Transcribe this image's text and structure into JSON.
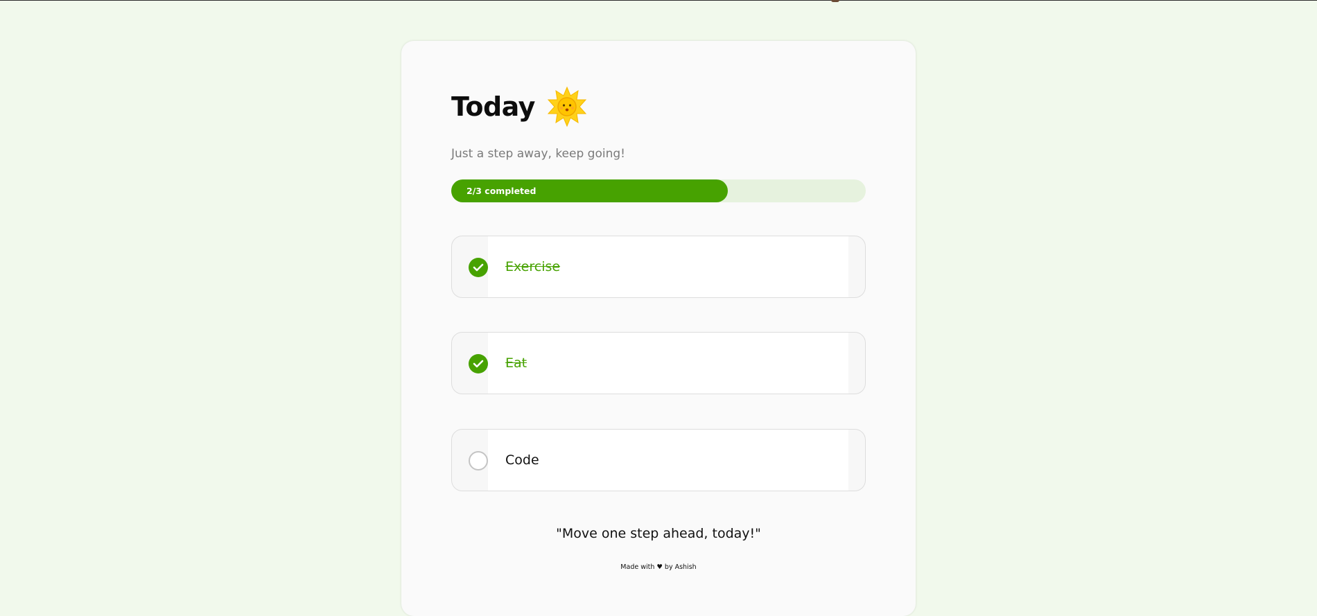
{
  "app": {
    "title": "Today",
    "subtitle": "Just a step away, keep going!",
    "header_icon": "sun-emoji-icon"
  },
  "progress": {
    "completed": 2,
    "total": 3,
    "fraction": 0.667,
    "label": "2/3 completed"
  },
  "tasks": [
    {
      "label": "Exercise",
      "done": true
    },
    {
      "label": "Eat",
      "done": true
    },
    {
      "label": "Code",
      "done": false
    }
  ],
  "quote": "\"Move one step ahead, today!\"",
  "footer": "Made with ♥ by Ashish",
  "colors": {
    "background": "#f1f9ec",
    "card": "#fafafa",
    "accent": "#47a201",
    "progress_track": "#e6f2de",
    "subtitle": "#7a7a7a"
  }
}
